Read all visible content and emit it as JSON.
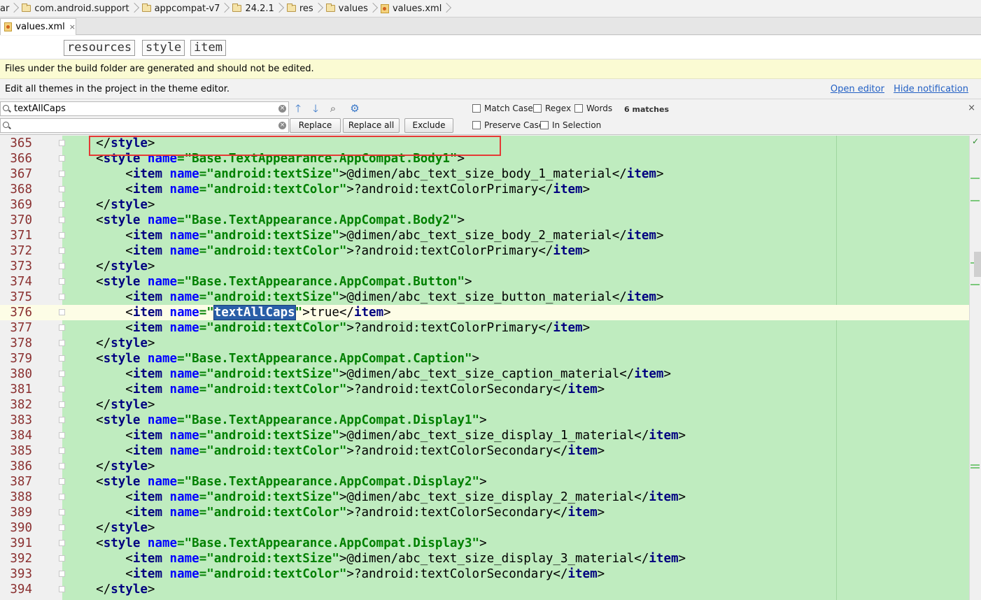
{
  "breadcrumb": [
    {
      "label": "ar",
      "icon": "none"
    },
    {
      "label": "com.android.support",
      "icon": "folder-icon"
    },
    {
      "label": "appcompat-v7",
      "icon": "folder-icon"
    },
    {
      "label": "24.2.1",
      "icon": "folder-icon"
    },
    {
      "label": "res",
      "icon": "folder-icon"
    },
    {
      "label": "values",
      "icon": "folder-icon"
    },
    {
      "label": "values.xml",
      "icon": "xml-file-icon"
    }
  ],
  "tab": {
    "label": "values.xml",
    "close": "×"
  },
  "tag_path": [
    "resources",
    "style",
    "item"
  ],
  "notification_generated": "Files under the build folder are generated and should not be edited.",
  "notification_theme": {
    "text": "Edit all themes in the project in the theme editor.",
    "open_editor": "Open editor",
    "hide_notification": "Hide notification"
  },
  "find": {
    "search_value": "textAllCaps",
    "replace_value": "",
    "replace_label": "Replace",
    "replace_all_label": "Replace all",
    "exclude_label": "Exclude",
    "match_case": "Match Case",
    "regex": "Regex",
    "words": "Words",
    "matches": "6 matches",
    "preserve_case": "Preserve Case",
    "in_selection": "In Selection",
    "close": "×"
  },
  "editor": {
    "highlight_line": "374",
    "current_line": "376",
    "lines": [
      {
        "n": "365",
        "indent": "    ",
        "parts": [
          [
            "p",
            "</"
          ],
          [
            "t",
            "style"
          ],
          [
            "p",
            ">"
          ]
        ]
      },
      {
        "n": "366",
        "indent": "    ",
        "parts": [
          [
            "p",
            "<"
          ],
          [
            "t",
            "style "
          ],
          [
            "a",
            "name"
          ],
          [
            "s",
            "=\"Base.TextAppearance.AppCompat.Body1\""
          ],
          [
            "p",
            ">"
          ]
        ]
      },
      {
        "n": "367",
        "indent": "        ",
        "parts": [
          [
            "p",
            "<"
          ],
          [
            "t",
            "item "
          ],
          [
            "a",
            "name"
          ],
          [
            "s",
            "=\"android:textSize\""
          ],
          [
            "p",
            ">@dimen/abc_text_size_body_1_material</"
          ],
          [
            "t",
            "item"
          ],
          [
            "p",
            ">"
          ]
        ]
      },
      {
        "n": "368",
        "indent": "        ",
        "parts": [
          [
            "p",
            "<"
          ],
          [
            "t",
            "item "
          ],
          [
            "a",
            "name"
          ],
          [
            "s",
            "=\"android:textColor\""
          ],
          [
            "p",
            ">?android:textColorPrimary</"
          ],
          [
            "t",
            "item"
          ],
          [
            "p",
            ">"
          ]
        ]
      },
      {
        "n": "369",
        "indent": "    ",
        "parts": [
          [
            "p",
            "</"
          ],
          [
            "t",
            "style"
          ],
          [
            "p",
            ">"
          ]
        ]
      },
      {
        "n": "370",
        "indent": "    ",
        "parts": [
          [
            "p",
            "<"
          ],
          [
            "t",
            "style "
          ],
          [
            "a",
            "name"
          ],
          [
            "s",
            "=\"Base.TextAppearance.AppCompat.Body2\""
          ],
          [
            "p",
            ">"
          ]
        ]
      },
      {
        "n": "371",
        "indent": "        ",
        "parts": [
          [
            "p",
            "<"
          ],
          [
            "t",
            "item "
          ],
          [
            "a",
            "name"
          ],
          [
            "s",
            "=\"android:textSize\""
          ],
          [
            "p",
            ">@dimen/abc_text_size_body_2_material</"
          ],
          [
            "t",
            "item"
          ],
          [
            "p",
            ">"
          ]
        ]
      },
      {
        "n": "372",
        "indent": "        ",
        "parts": [
          [
            "p",
            "<"
          ],
          [
            "t",
            "item "
          ],
          [
            "a",
            "name"
          ],
          [
            "s",
            "=\"android:textColor\""
          ],
          [
            "p",
            ">?android:textColorPrimary</"
          ],
          [
            "t",
            "item"
          ],
          [
            "p",
            ">"
          ]
        ]
      },
      {
        "n": "373",
        "indent": "    ",
        "parts": [
          [
            "p",
            "</"
          ],
          [
            "t",
            "style"
          ],
          [
            "p",
            ">"
          ]
        ]
      },
      {
        "n": "374",
        "indent": "    ",
        "parts": [
          [
            "p",
            "<"
          ],
          [
            "t",
            "style "
          ],
          [
            "a",
            "name"
          ],
          [
            "s",
            "=\"Base.TextAppearance.AppCompat.Button\""
          ],
          [
            "p",
            ">"
          ]
        ]
      },
      {
        "n": "375",
        "indent": "        ",
        "parts": [
          [
            "p",
            "<"
          ],
          [
            "t",
            "item "
          ],
          [
            "a",
            "name"
          ],
          [
            "s",
            "=\"android:textSize\""
          ],
          [
            "p",
            ">@dimen/abc_text_size_button_material</"
          ],
          [
            "t",
            "item"
          ],
          [
            "p",
            ">"
          ]
        ]
      },
      {
        "n": "376",
        "indent": "        ",
        "parts": [
          [
            "p",
            "<"
          ],
          [
            "t",
            "item "
          ],
          [
            "a",
            "name"
          ],
          [
            "s",
            "=\""
          ],
          [
            "hl",
            "textAllCaps"
          ],
          [
            "s",
            "\""
          ],
          [
            "p",
            ">true</"
          ],
          [
            "t",
            "item"
          ],
          [
            "p",
            ">"
          ]
        ]
      },
      {
        "n": "377",
        "indent": "        ",
        "parts": [
          [
            "p",
            "<"
          ],
          [
            "t",
            "item "
          ],
          [
            "a",
            "name"
          ],
          [
            "s",
            "=\"android:textColor\""
          ],
          [
            "p",
            ">?android:textColorPrimary</"
          ],
          [
            "t",
            "item"
          ],
          [
            "p",
            ">"
          ]
        ]
      },
      {
        "n": "378",
        "indent": "    ",
        "parts": [
          [
            "p",
            "</"
          ],
          [
            "t",
            "style"
          ],
          [
            "p",
            ">"
          ]
        ]
      },
      {
        "n": "379",
        "indent": "    ",
        "parts": [
          [
            "p",
            "<"
          ],
          [
            "t",
            "style "
          ],
          [
            "a",
            "name"
          ],
          [
            "s",
            "=\"Base.TextAppearance.AppCompat.Caption\""
          ],
          [
            "p",
            ">"
          ]
        ]
      },
      {
        "n": "380",
        "indent": "        ",
        "parts": [
          [
            "p",
            "<"
          ],
          [
            "t",
            "item "
          ],
          [
            "a",
            "name"
          ],
          [
            "s",
            "=\"android:textSize\""
          ],
          [
            "p",
            ">@dimen/abc_text_size_caption_material</"
          ],
          [
            "t",
            "item"
          ],
          [
            "p",
            ">"
          ]
        ]
      },
      {
        "n": "381",
        "indent": "        ",
        "parts": [
          [
            "p",
            "<"
          ],
          [
            "t",
            "item "
          ],
          [
            "a",
            "name"
          ],
          [
            "s",
            "=\"android:textColor\""
          ],
          [
            "p",
            ">?android:textColorSecondary</"
          ],
          [
            "t",
            "item"
          ],
          [
            "p",
            ">"
          ]
        ]
      },
      {
        "n": "382",
        "indent": "    ",
        "parts": [
          [
            "p",
            "</"
          ],
          [
            "t",
            "style"
          ],
          [
            "p",
            ">"
          ]
        ]
      },
      {
        "n": "383",
        "indent": "    ",
        "parts": [
          [
            "p",
            "<"
          ],
          [
            "t",
            "style "
          ],
          [
            "a",
            "name"
          ],
          [
            "s",
            "=\"Base.TextAppearance.AppCompat.Display1\""
          ],
          [
            "p",
            ">"
          ]
        ]
      },
      {
        "n": "384",
        "indent": "        ",
        "parts": [
          [
            "p",
            "<"
          ],
          [
            "t",
            "item "
          ],
          [
            "a",
            "name"
          ],
          [
            "s",
            "=\"android:textSize\""
          ],
          [
            "p",
            ">@dimen/abc_text_size_display_1_material</"
          ],
          [
            "t",
            "item"
          ],
          [
            "p",
            ">"
          ]
        ]
      },
      {
        "n": "385",
        "indent": "        ",
        "parts": [
          [
            "p",
            "<"
          ],
          [
            "t",
            "item "
          ],
          [
            "a",
            "name"
          ],
          [
            "s",
            "=\"android:textColor\""
          ],
          [
            "p",
            ">?android:textColorSecondary</"
          ],
          [
            "t",
            "item"
          ],
          [
            "p",
            ">"
          ]
        ]
      },
      {
        "n": "386",
        "indent": "    ",
        "parts": [
          [
            "p",
            "</"
          ],
          [
            "t",
            "style"
          ],
          [
            "p",
            ">"
          ]
        ]
      },
      {
        "n": "387",
        "indent": "    ",
        "parts": [
          [
            "p",
            "<"
          ],
          [
            "t",
            "style "
          ],
          [
            "a",
            "name"
          ],
          [
            "s",
            "=\"Base.TextAppearance.AppCompat.Display2\""
          ],
          [
            "p",
            ">"
          ]
        ]
      },
      {
        "n": "388",
        "indent": "        ",
        "parts": [
          [
            "p",
            "<"
          ],
          [
            "t",
            "item "
          ],
          [
            "a",
            "name"
          ],
          [
            "s",
            "=\"android:textSize\""
          ],
          [
            "p",
            ">@dimen/abc_text_size_display_2_material</"
          ],
          [
            "t",
            "item"
          ],
          [
            "p",
            ">"
          ]
        ]
      },
      {
        "n": "389",
        "indent": "        ",
        "parts": [
          [
            "p",
            "<"
          ],
          [
            "t",
            "item "
          ],
          [
            "a",
            "name"
          ],
          [
            "s",
            "=\"android:textColor\""
          ],
          [
            "p",
            ">?android:textColorSecondary</"
          ],
          [
            "t",
            "item"
          ],
          [
            "p",
            ">"
          ]
        ]
      },
      {
        "n": "390",
        "indent": "    ",
        "parts": [
          [
            "p",
            "</"
          ],
          [
            "t",
            "style"
          ],
          [
            "p",
            ">"
          ]
        ]
      },
      {
        "n": "391",
        "indent": "    ",
        "parts": [
          [
            "p",
            "<"
          ],
          [
            "t",
            "style "
          ],
          [
            "a",
            "name"
          ],
          [
            "s",
            "=\"Base.TextAppearance.AppCompat.Display3\""
          ],
          [
            "p",
            ">"
          ]
        ]
      },
      {
        "n": "392",
        "indent": "        ",
        "parts": [
          [
            "p",
            "<"
          ],
          [
            "t",
            "item "
          ],
          [
            "a",
            "name"
          ],
          [
            "s",
            "=\"android:textSize\""
          ],
          [
            "p",
            ">@dimen/abc_text_size_display_3_material</"
          ],
          [
            "t",
            "item"
          ],
          [
            "p",
            ">"
          ]
        ]
      },
      {
        "n": "393",
        "indent": "        ",
        "parts": [
          [
            "p",
            "<"
          ],
          [
            "t",
            "item "
          ],
          [
            "a",
            "name"
          ],
          [
            "s",
            "=\"android:textColor\""
          ],
          [
            "p",
            ">?android:textColorSecondary</"
          ],
          [
            "t",
            "item"
          ],
          [
            "p",
            ">"
          ]
        ]
      },
      {
        "n": "394",
        "indent": "    ",
        "parts": [
          [
            "p",
            "</"
          ],
          [
            "t",
            "style"
          ],
          [
            "p",
            ">"
          ]
        ]
      }
    ]
  },
  "colors": {
    "editor_background": "#bfecbf",
    "tag": "#000080",
    "attribute": "#0000ff",
    "string": "#008000",
    "match_highlight": "#2a5fa8",
    "annotation_box": "#e53935",
    "notification_yellow": "#fbfbd3",
    "link": "#2360c4"
  }
}
